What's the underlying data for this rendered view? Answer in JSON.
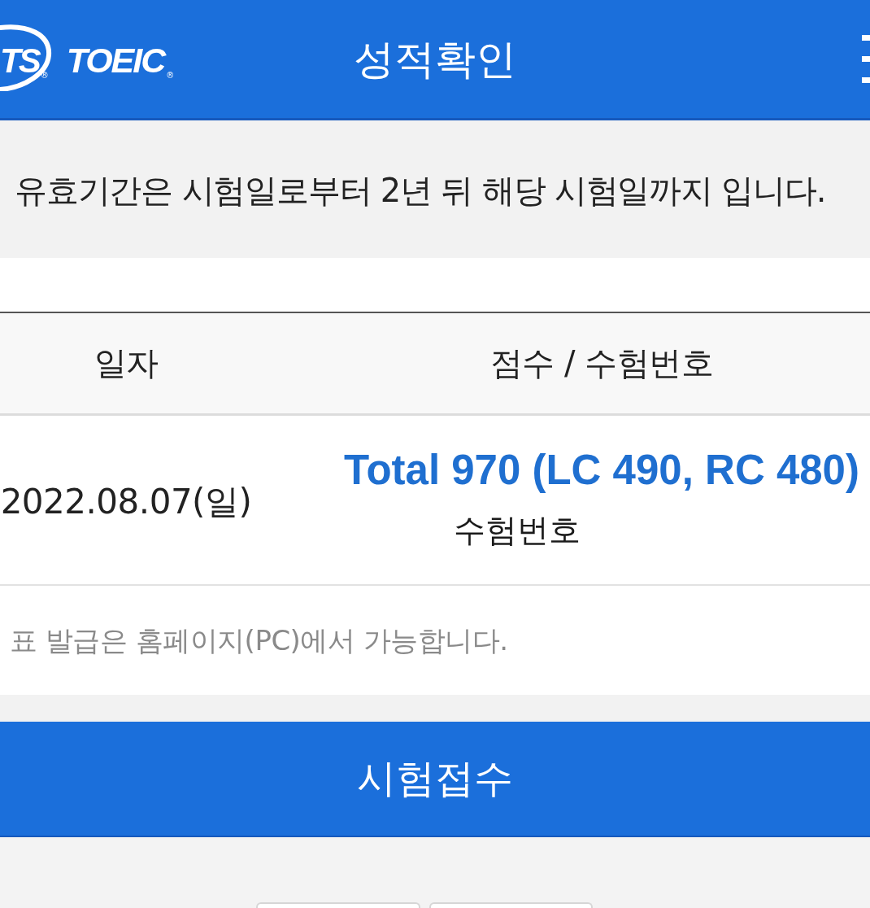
{
  "header": {
    "logo": {
      "mark": "TS",
      "mark_symbol": "®",
      "wordmark": "TOEIC",
      "wordmark_symbol": "®"
    },
    "title": "성적확인"
  },
  "notice": "유효기간은 시험일로부터 2년 뒤 해당 시험일까지 입니다.",
  "table": {
    "columns": [
      "일자",
      "점수 / 수험번호"
    ],
    "rows": [
      {
        "date": "2022.08.07(일)",
        "score": "Total 970 (LC 490, RC 480)",
        "exam_number_label": "수험번호"
      }
    ]
  },
  "footnote": "표 발급은 홈페이지(PC)에서 가능합니다.",
  "primary_button": "시험접수"
}
